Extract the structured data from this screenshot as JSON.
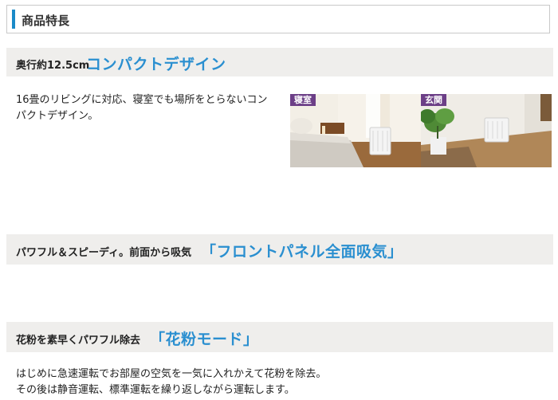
{
  "header": {
    "title": "商品特長"
  },
  "sections": [
    {
      "lead": "奥行約12.5cm",
      "accent": "コンパクトデザイン",
      "desc_lines": [
        "16畳のリビングに対応、寝室でも場所をとらないコン",
        "パクトデザイン。"
      ],
      "photos": [
        {
          "label": "寝室"
        },
        {
          "label": "玄関"
        }
      ]
    },
    {
      "lead": "パワフル＆スピーディ。前面から吸気",
      "accent": "「フロントパネル全面吸気」"
    },
    {
      "lead": "花粉を素早くパワフル除去",
      "accent": "「花粉モード」",
      "desc_lines": [
        "はじめに急速運転でお部屋の空気を一気に入れかえて花粉を除去。",
        "その後は静音運転、標準運転を繰り返しながら運転します。"
      ]
    }
  ],
  "colors": {
    "accent": "#2a8fd0",
    "band_bg": "#efeeec",
    "tag_bg": "#6c3f87",
    "header_bar": "#1a8ac8"
  }
}
